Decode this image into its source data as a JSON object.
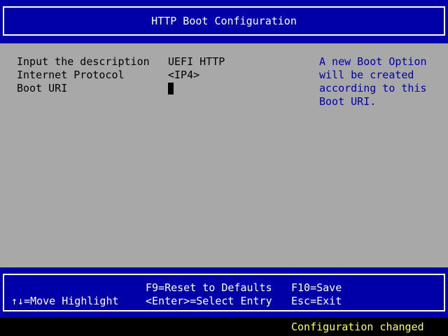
{
  "header": {
    "title": "HTTP Boot Configuration"
  },
  "form": {
    "rows": [
      {
        "label": "Input the description",
        "value": "UEFI HTTP"
      },
      {
        "label": "Internet Protocol",
        "value": "<IP4>"
      },
      {
        "label": "Boot URI",
        "value": ""
      }
    ]
  },
  "help": {
    "text": "A new Boot Option\nwill be created\naccording to this\nBoot URI."
  },
  "footer": {
    "move_highlight": "↑↓=Move Highlight",
    "reset_defaults": "F9=Reset to Defaults",
    "select_entry": "<Enter>=Select Entry",
    "save": "F10=Save",
    "exit": "Esc=Exit"
  },
  "status": {
    "message": "Configuration changed"
  },
  "colors": {
    "background_blue": "#0000a8",
    "panel_gray": "#a8a8a8",
    "help_text_blue": "#0000a8",
    "status_yellow": "#ffff55"
  }
}
